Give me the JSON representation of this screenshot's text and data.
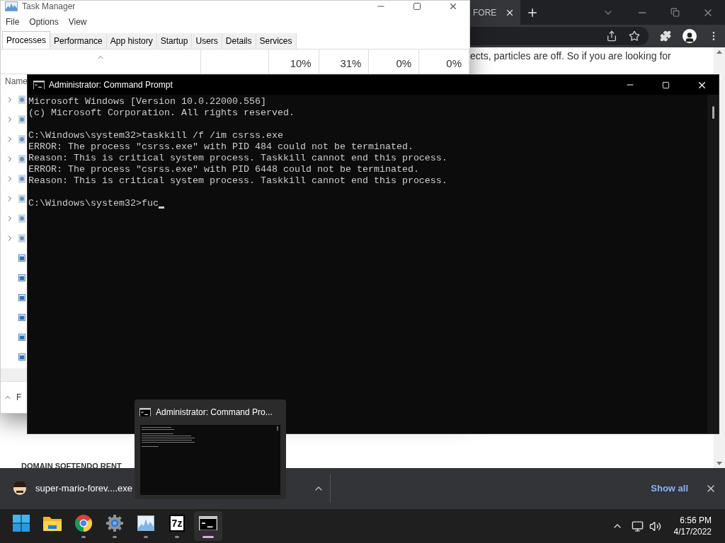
{
  "browser": {
    "tab_title": "FORE",
    "page_text": "ects, particles are off. So if you are looking for",
    "heading": "DOMAIN SOFTENDO RENT"
  },
  "task_manager": {
    "title": "Task Manager",
    "menu": [
      "File",
      "Options",
      "View"
    ],
    "tabs": [
      {
        "label": "Processes",
        "selected": true
      },
      {
        "label": "Performance",
        "selected": false
      },
      {
        "label": "App history",
        "selected": false
      },
      {
        "label": "Startup",
        "selected": false
      },
      {
        "label": "Users",
        "selected": false
      },
      {
        "label": "Details",
        "selected": false
      },
      {
        "label": "Services",
        "selected": false
      }
    ],
    "column_totals": [
      "10%",
      "31%",
      "0%",
      "0%"
    ],
    "name_header": "Name",
    "rows": [
      {
        "expandable": true
      },
      {
        "expandable": true
      },
      {
        "expandable": true
      },
      {
        "expandable": true
      },
      {
        "expandable": true
      },
      {
        "expandable": true
      },
      {
        "expandable": true
      },
      {
        "expandable": true
      },
      {
        "expandable": false
      },
      {
        "expandable": false
      },
      {
        "expandable": false
      },
      {
        "expandable": false
      },
      {
        "expandable": false
      },
      {
        "expandable": false
      }
    ],
    "footer_text": "F"
  },
  "command_prompt": {
    "title": "Administrator: Command Prompt",
    "blocks": [
      [
        "Microsoft Windows [Version 10.0.22000.556]",
        "(c) Microsoft Corporation. All rights reserved."
      ],
      [
        "C:\\Windows\\system32>taskkill /f /im csrss.exe",
        "ERROR: The process \"csrss.exe\" with PID 484 could not be terminated.",
        "Reason: This is critical system process. Taskkill cannot end this process.",
        "ERROR: The process \"csrss.exe\" with PID 6448 could not be terminated.",
        "Reason: This is critical system process. Taskkill cannot end this process."
      ]
    ],
    "prompt": "C:\\Windows\\system32>fuc"
  },
  "preview": {
    "title": "Administrator: Command Pro..."
  },
  "downloads": {
    "file": "super-mario-forev....exe",
    "show_all": "Show all"
  },
  "taskbar": {
    "apps": [
      {
        "kind": "start",
        "running": false,
        "active": false
      },
      {
        "kind": "explorer",
        "running": false,
        "active": false
      },
      {
        "kind": "chrome",
        "running": true,
        "active": false
      },
      {
        "kind": "settings",
        "running": true,
        "active": false
      },
      {
        "kind": "taskmgr",
        "running": true,
        "active": false
      },
      {
        "kind": "archiver",
        "label": "7z",
        "running": true,
        "active": false
      },
      {
        "kind": "terminal",
        "running": true,
        "active": true
      }
    ],
    "time": "6:56 PM",
    "date": "4/17/2022"
  }
}
